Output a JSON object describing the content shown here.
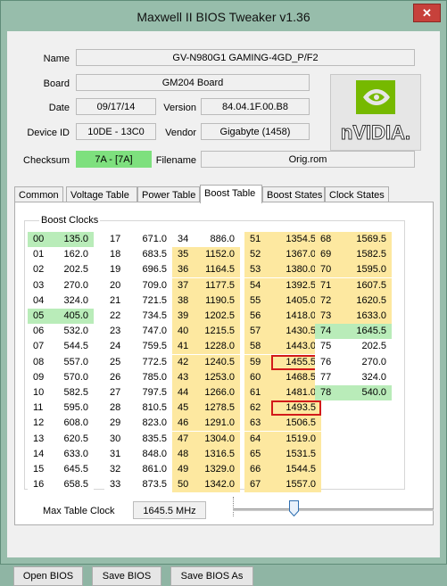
{
  "window": {
    "title": "Maxwell II BIOS Tweaker v1.36",
    "close": "✕"
  },
  "info": {
    "name_label": "Name",
    "name": "GV-N980G1 GAMING-4GD_P/F2",
    "board_label": "Board",
    "board": "GM204 Board",
    "date_label": "Date",
    "date": "09/17/14",
    "version_label": "Version",
    "version": "84.04.1F.00.B8",
    "device_label": "Device ID",
    "device": "10DE - 13C0",
    "vendor_label": "Vendor",
    "vendor": "Gigabyte (1458)",
    "checksum_label": "Checksum",
    "checksum": "7A - [7A]",
    "filename_label": "Filename",
    "filename": "Orig.rom"
  },
  "logo": {
    "text": "nVIDIA."
  },
  "tabs": [
    "Common",
    "Voltage Table",
    "Power Table",
    "Boost Table",
    "Boost States",
    "Clock States"
  ],
  "active_tab": "Boost Table",
  "boost": {
    "group_label": "Boost Clocks",
    "columns": [
      [
        [
          "00",
          "135.0"
        ],
        [
          "01",
          "162.0"
        ],
        [
          "02",
          "202.5"
        ],
        [
          "03",
          "270.0"
        ],
        [
          "04",
          "324.0"
        ],
        [
          "05",
          "405.0"
        ],
        [
          "06",
          "532.0"
        ],
        [
          "07",
          "544.5"
        ],
        [
          "08",
          "557.0"
        ],
        [
          "09",
          "570.0"
        ],
        [
          "10",
          "582.5"
        ],
        [
          "11",
          "595.0"
        ],
        [
          "12",
          "608.0"
        ],
        [
          "13",
          "620.5"
        ],
        [
          "14",
          "633.0"
        ],
        [
          "15",
          "645.5"
        ],
        [
          "16",
          "658.5"
        ]
      ],
      [
        [
          "17",
          "671.0"
        ],
        [
          "18",
          "683.5"
        ],
        [
          "19",
          "696.5"
        ],
        [
          "20",
          "709.0"
        ],
        [
          "21",
          "721.5"
        ],
        [
          "22",
          "734.5"
        ],
        [
          "23",
          "747.0"
        ],
        [
          "24",
          "759.5"
        ],
        [
          "25",
          "772.5"
        ],
        [
          "26",
          "785.0"
        ],
        [
          "27",
          "797.5"
        ],
        [
          "28",
          "810.5"
        ],
        [
          "29",
          "823.0"
        ],
        [
          "30",
          "835.5"
        ],
        [
          "31",
          "848.0"
        ],
        [
          "32",
          "861.0"
        ],
        [
          "33",
          "873.5"
        ]
      ],
      [
        [
          "34",
          "886.0"
        ],
        [
          "35",
          "1152.0"
        ],
        [
          "36",
          "1164.5"
        ],
        [
          "37",
          "1177.5"
        ],
        [
          "38",
          "1190.5"
        ],
        [
          "39",
          "1202.5"
        ],
        [
          "40",
          "1215.5"
        ],
        [
          "41",
          "1228.0"
        ],
        [
          "42",
          "1240.5"
        ],
        [
          "43",
          "1253.0"
        ],
        [
          "44",
          "1266.0"
        ],
        [
          "45",
          "1278.5"
        ],
        [
          "46",
          "1291.0"
        ],
        [
          "47",
          "1304.0"
        ],
        [
          "48",
          "1316.5"
        ],
        [
          "49",
          "1329.0"
        ],
        [
          "50",
          "1342.0"
        ]
      ],
      [
        [
          "51",
          "1354.5"
        ],
        [
          "52",
          "1367.0"
        ],
        [
          "53",
          "1380.0"
        ],
        [
          "54",
          "1392.5"
        ],
        [
          "55",
          "1405.0"
        ],
        [
          "56",
          "1418.0"
        ],
        [
          "57",
          "1430.5"
        ],
        [
          "58",
          "1443.0"
        ],
        [
          "59",
          "1455.5"
        ],
        [
          "60",
          "1468.5"
        ],
        [
          "61",
          "1481.0"
        ],
        [
          "62",
          "1493.5"
        ],
        [
          "63",
          "1506.5"
        ],
        [
          "64",
          "1519.0"
        ],
        [
          "65",
          "1531.5"
        ],
        [
          "66",
          "1544.5"
        ],
        [
          "67",
          "1557.0"
        ]
      ],
      [
        [
          "68",
          "1569.5"
        ],
        [
          "69",
          "1582.5"
        ],
        [
          "70",
          "1595.0"
        ],
        [
          "71",
          "1607.5"
        ],
        [
          "72",
          "1620.5"
        ],
        [
          "73",
          "1633.0"
        ],
        [
          "74",
          "1645.5"
        ],
        [
          "75",
          "202.5"
        ],
        [
          "76",
          "270.0"
        ],
        [
          "77",
          "324.0"
        ],
        [
          "78",
          "540.0"
        ]
      ]
    ],
    "max_label": "Max Table Clock",
    "max_value": "1645.5 MHz",
    "slider_position": 0.3
  },
  "buttons": {
    "open": "Open BIOS",
    "save": "Save BIOS",
    "save_as": "Save BIOS As"
  },
  "colors": {
    "yellow": "#fde8a0",
    "green": "#b9ecb9",
    "highlight": "#d21a1a"
  }
}
